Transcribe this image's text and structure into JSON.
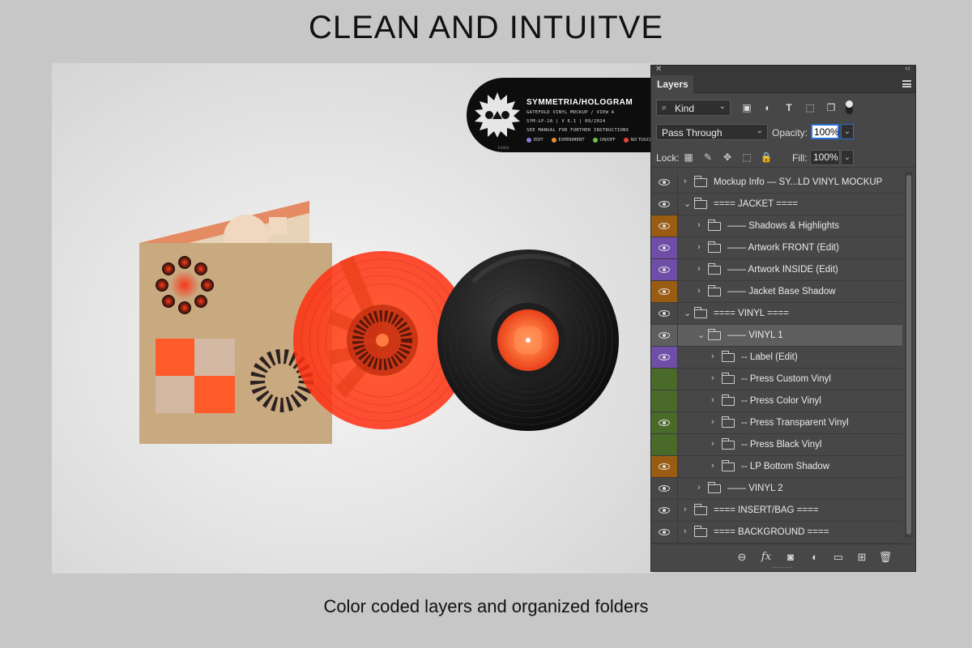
{
  "headline": "CLEAN AND INTUITVE",
  "caption": "Color coded layers and organized folders",
  "info_label": {
    "title": "SYMMETRIA/HOLOGRAM",
    "lines": [
      "GATEFOLD VINYL MOCKUP / VIEW A",
      "SYM-LP-2A  |  V 6.1  |  09/2024",
      "SEE MANUAL FOR FURTHER INSTRUCTIONS"
    ],
    "legend": [
      {
        "label": "EDIT",
        "color": "#8e7ae0"
      },
      {
        "label": "EXPERIMENT",
        "color": "#e8902e"
      },
      {
        "label": "ON/OFF",
        "color": "#6fc34a"
      },
      {
        "label": "NO TOUCH",
        "color": "#e8433a"
      }
    ],
    "year": "©2024"
  },
  "panel": {
    "tab": "Layers",
    "kind": "Kind",
    "blend_mode": "Pass Through",
    "opacity_label": "Opacity:",
    "opacity_value": "100%",
    "lock_label": "Lock:",
    "fill_label": "Fill:",
    "fill_value": "100%"
  },
  "colors": {
    "orange": "#9a5b13",
    "violet": "#6f4ea8",
    "green": "#4a6a2a",
    "vinyl_red": "#ff3a1a",
    "card": "#c9a980"
  },
  "layers": [
    {
      "name": "Mockup Info — SY...LD VINYL MOCKUP",
      "indent": 0,
      "expanded": false,
      "tag": "none",
      "visible": true
    },
    {
      "name": "==== JACKET ====",
      "indent": 0,
      "expanded": true,
      "tag": "none",
      "visible": true
    },
    {
      "name": "—— Shadows & Highlights",
      "indent": 1,
      "expanded": false,
      "tag": "orange",
      "visible": true
    },
    {
      "name": "—— Artwork FRONT (Edit)",
      "indent": 1,
      "expanded": false,
      "tag": "violet",
      "visible": true
    },
    {
      "name": "—— Artwork INSIDE (Edit)",
      "indent": 1,
      "expanded": false,
      "tag": "violet",
      "visible": true
    },
    {
      "name": "—— Jacket Base Shadow",
      "indent": 1,
      "expanded": false,
      "tag": "orange",
      "visible": true
    },
    {
      "name": "==== VINYL ====",
      "indent": 0,
      "expanded": true,
      "tag": "none",
      "visible": true
    },
    {
      "name": "—— VINYL 1",
      "indent": 1,
      "expanded": true,
      "tag": "none",
      "visible": true,
      "selected": true
    },
    {
      "name": "-- Label (Edit)",
      "indent": 2,
      "expanded": false,
      "tag": "violet",
      "visible": true
    },
    {
      "name": "-- Press Custom Vinyl",
      "indent": 2,
      "expanded": false,
      "tag": "green",
      "visible": false
    },
    {
      "name": "-- Press Color Vinyl",
      "indent": 2,
      "expanded": false,
      "tag": "green",
      "visible": false
    },
    {
      "name": "-- Press Transparent Vinyl",
      "indent": 2,
      "expanded": false,
      "tag": "green",
      "visible": true
    },
    {
      "name": "-- Press Black Vinyl",
      "indent": 2,
      "expanded": false,
      "tag": "green",
      "visible": false
    },
    {
      "name": "-- LP Bottom Shadow",
      "indent": 2,
      "expanded": false,
      "tag": "orange",
      "visible": true
    },
    {
      "name": "—— VINYL 2",
      "indent": 1,
      "expanded": false,
      "tag": "none",
      "visible": true
    },
    {
      "name": "==== INSERT/BAG ====",
      "indent": 0,
      "expanded": false,
      "tag": "none",
      "visible": true
    },
    {
      "name": "==== BACKGROUND ====",
      "indent": 0,
      "expanded": false,
      "tag": "none",
      "visible": true
    }
  ],
  "icons": {
    "filters": [
      "image-filter-icon",
      "adjustment-filter-icon",
      "type-filter-icon",
      "shape-filter-icon",
      "smart-object-filter-icon"
    ],
    "locks": [
      "lock-transparent-icon",
      "lock-paint-icon",
      "lock-move-icon",
      "lock-artboard-icon",
      "lock-all-icon"
    ],
    "bottom": [
      "link-layers-icon",
      "fx-icon",
      "add-mask-icon",
      "adjustment-layer-icon",
      "new-group-icon",
      "new-layer-icon",
      "delete-icon"
    ]
  }
}
